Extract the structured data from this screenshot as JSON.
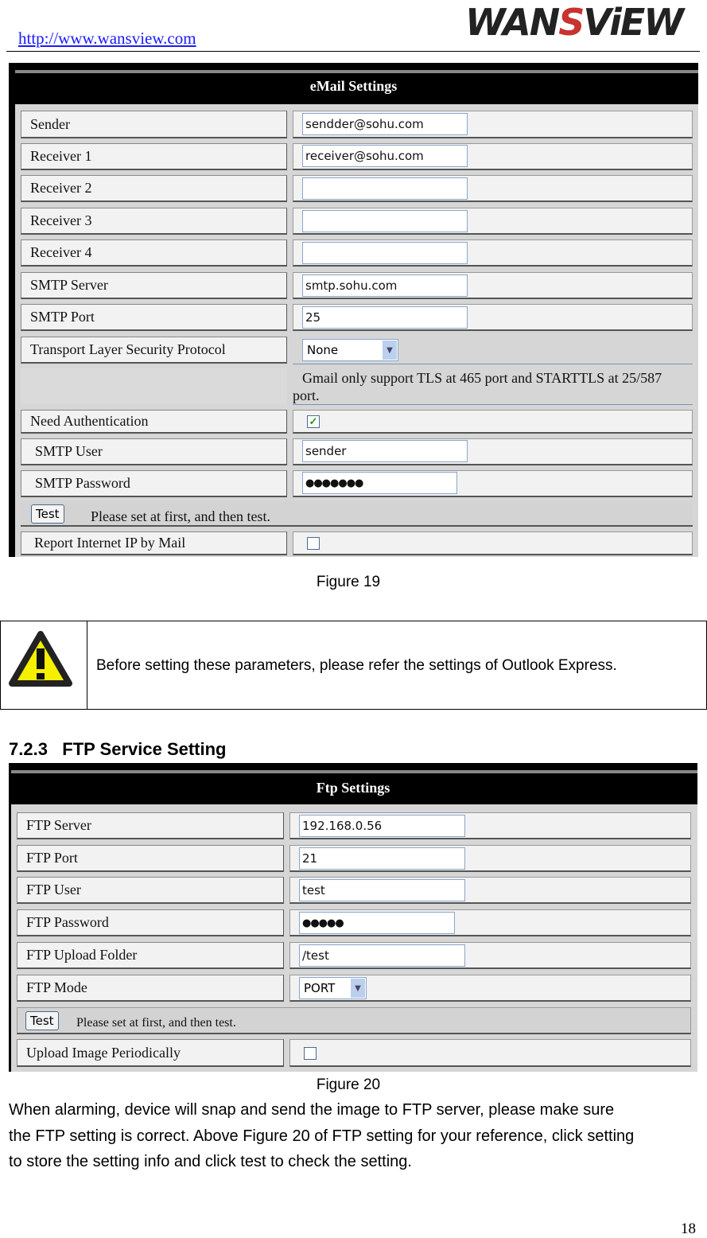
{
  "header": {
    "url": "http://www.wansview.com",
    "logo_text": "WANSVIEW"
  },
  "email": {
    "title": "eMail Settings",
    "rows": [
      {
        "label": "Sender",
        "value": "sendder@sohu.com"
      },
      {
        "label": "Receiver 1",
        "value": "receiver@sohu.com"
      },
      {
        "label": "Receiver 2",
        "value": ""
      },
      {
        "label": "Receiver 3",
        "value": ""
      },
      {
        "label": "Receiver 4",
        "value": ""
      },
      {
        "label": "SMTP Server",
        "value": "smtp.sohu.com"
      },
      {
        "label": "SMTP Port",
        "value": "25"
      }
    ],
    "tls_label": "Transport Layer Security Protocol",
    "tls_value": "None",
    "gmail_note_1": "Gmail only support TLS at 465 port and STARTTLS at 25/587",
    "gmail_note_2": "port.",
    "auth_label": "Need Authentication",
    "auth_checked": true,
    "user_label": "SMTP User",
    "user_value": "sender",
    "password_label": "SMTP Password",
    "password_value": "●●●●●●●",
    "test_label": "Test",
    "test_note": "Please set at first, and then test.",
    "report_label": "Report Internet IP by Mail",
    "report_checked": false
  },
  "caption19": "Figure 19",
  "warning": {
    "icon": "warning-icon",
    "text": "Before setting these parameters, please refer the settings of Outlook Express."
  },
  "section": {
    "number": "7.2.3",
    "title": "FTP Service Setting"
  },
  "ftp": {
    "title": "Ftp Settings",
    "rows": [
      {
        "label": "FTP Server",
        "value": "192.168.0.56"
      },
      {
        "label": "FTP Port",
        "value": "21"
      },
      {
        "label": "FTP User",
        "value": "test"
      },
      {
        "label": "FTP Password",
        "value": "●●●●●"
      },
      {
        "label": "FTP Upload Folder",
        "value": "/test"
      }
    ],
    "mode_label": "FTP Mode",
    "mode_value": "PORT",
    "test_label": "Test",
    "test_note": "Please set at first, and then test.",
    "upload_label": "Upload Image Periodically",
    "upload_checked": false
  },
  "caption20": "Figure 20",
  "body_lines": [
    "When alarming, device will snap and send the image to FTP server, please make sure",
    "the FTP setting is correct. Above Figure 20 of FTP setting for your reference, click setting",
    "to store the setting info and click test to check the setting."
  ],
  "page_number": "18"
}
